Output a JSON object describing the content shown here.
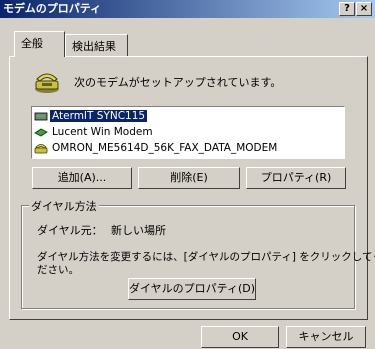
{
  "window": {
    "title": "モデムのプロパティ",
    "help_btn": "?",
    "close_btn": "×"
  },
  "tabs": [
    {
      "label": "全般"
    },
    {
      "label": "検出結果"
    }
  ],
  "header": {
    "text": "次のモデムがセットアップされています。"
  },
  "modems": [
    {
      "label": "AtermIT SYNC115",
      "selected": true
    },
    {
      "label": "Lucent Win Modem",
      "selected": false
    },
    {
      "label": "OMRON_ME5614D_56K_FAX_DATA_MODEM",
      "selected": false
    }
  ],
  "buttons": {
    "add": "追加(A)...",
    "remove": "削除(E)",
    "properties": "プロパティ(R)"
  },
  "dialing": {
    "group_label": "ダイヤル方法",
    "from_label": "ダイヤル元：",
    "from_value": "新しい場所",
    "description_line1": "ダイヤル方法を変更するには、[ダイヤルのプロパティ] をクリックしてく",
    "description_line2": "ださい。",
    "dialing_properties_button": "ダイヤルのプロパティ(D)"
  },
  "footer": {
    "ok": "OK",
    "cancel": "キャンセル"
  }
}
